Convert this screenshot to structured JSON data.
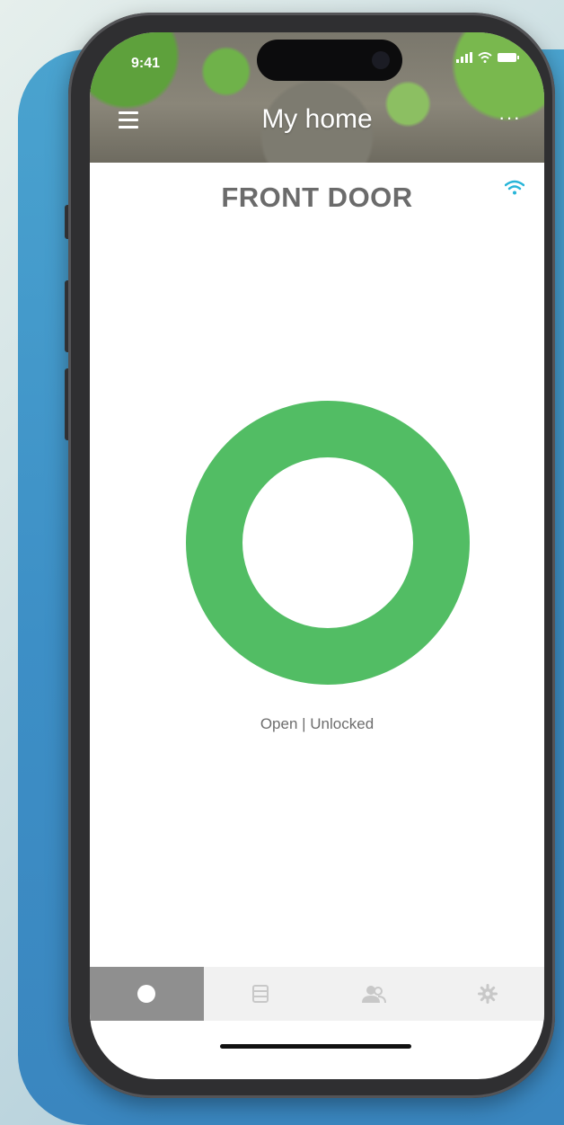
{
  "status_bar": {
    "time": "9:41"
  },
  "header": {
    "title": "My home",
    "more_label": "···"
  },
  "door": {
    "name": "FRONT DOOR",
    "status": "Open | Unlocked"
  },
  "tabs": [
    {
      "icon": "lock-status-icon",
      "active": true
    },
    {
      "icon": "list-icon",
      "active": false
    },
    {
      "icon": "users-icon",
      "active": false
    },
    {
      "icon": "gear-icon",
      "active": false
    }
  ],
  "colors": {
    "ring": "#52bd64",
    "wifi": "#28b5d8",
    "active_tab": "#8f8f8f",
    "background_panel": "#3d8fc6"
  }
}
